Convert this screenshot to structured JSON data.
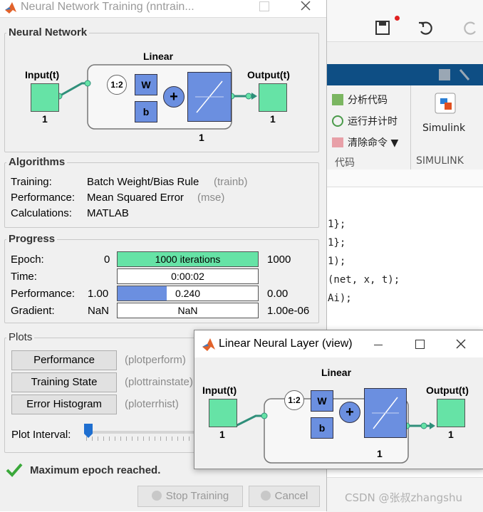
{
  "background": {
    "ribbon": {
      "analyze_code": "分析代码",
      "run_time": "运行并计时",
      "clear_commands": "清除命令",
      "section_code": "代码",
      "simulink_label": "Simulink",
      "section_simulink": "SIMULINK"
    },
    "code_lines": [
      "1};",
      "1};",
      "1);",
      "(net, x, t);",
      "Ai);"
    ],
    "watermark": "CSDN @张叔zhangshu"
  },
  "train_window": {
    "title": "Neural Network Training (nntrain...",
    "network": {
      "section_title": "Neural Network",
      "layer_title": "Linear",
      "input_label": "Input(t)",
      "input_size": "1",
      "output_label": "Output(t)",
      "output_size": "1",
      "layer_size": "1",
      "delay_label": "1:2",
      "weight_label": "W",
      "bias_label": "b"
    },
    "algorithms": {
      "section_title": "Algorithms",
      "rows": [
        {
          "label": "Training:",
          "value": "Batch Weight/Bias Rule",
          "code": "(trainb)"
        },
        {
          "label": "Performance:",
          "value": "Mean Squared Error",
          "code": "(mse)"
        },
        {
          "label": "Calculations:",
          "value": "MATLAB",
          "code": ""
        }
      ]
    },
    "progress": {
      "section_title": "Progress",
      "epoch": {
        "label": "Epoch:",
        "start": "0",
        "bar_text": "1000 iterations",
        "end": "1000",
        "fill": 1.0
      },
      "time": {
        "label": "Time:",
        "start": "",
        "bar_text": "0:00:02",
        "end": "",
        "fill": 0
      },
      "performance": {
        "label": "Performance:",
        "start": "1.00",
        "bar_text": "0.240",
        "end": "0.00",
        "fill": 0.35
      },
      "gradient": {
        "label": "Gradient:",
        "start": "NaN",
        "bar_text": "NaN",
        "end": "1.00e-06",
        "fill": 0
      }
    },
    "plots": {
      "section_title": "Plots",
      "buttons": [
        {
          "label": "Performance",
          "fn": "(plotperform)"
        },
        {
          "label": "Training State",
          "fn": "(plottrainstate)"
        },
        {
          "label": "Error Histogram",
          "fn": "(ploterrhist)"
        }
      ],
      "interval_label": "Plot Interval:"
    },
    "status": "Maximum epoch reached.",
    "stop_button": "Stop Training",
    "cancel_button": "Cancel"
  },
  "layer_window": {
    "title": "Linear Neural Layer (view)",
    "layer_title": "Linear",
    "input_label": "Input(t)",
    "input_size": "1",
    "output_label": "Output(t)",
    "output_size": "1",
    "layer_size": "1",
    "delay_label": "1:2",
    "weight_label": "W",
    "bias_label": "b"
  },
  "colors": {
    "io_box": "#66e3a6",
    "weight_box": "#6b8fe0",
    "window_bg": "#f0f0f0",
    "ribbon_blue": "#0e4e84",
    "status_green": "#3aa83a"
  }
}
